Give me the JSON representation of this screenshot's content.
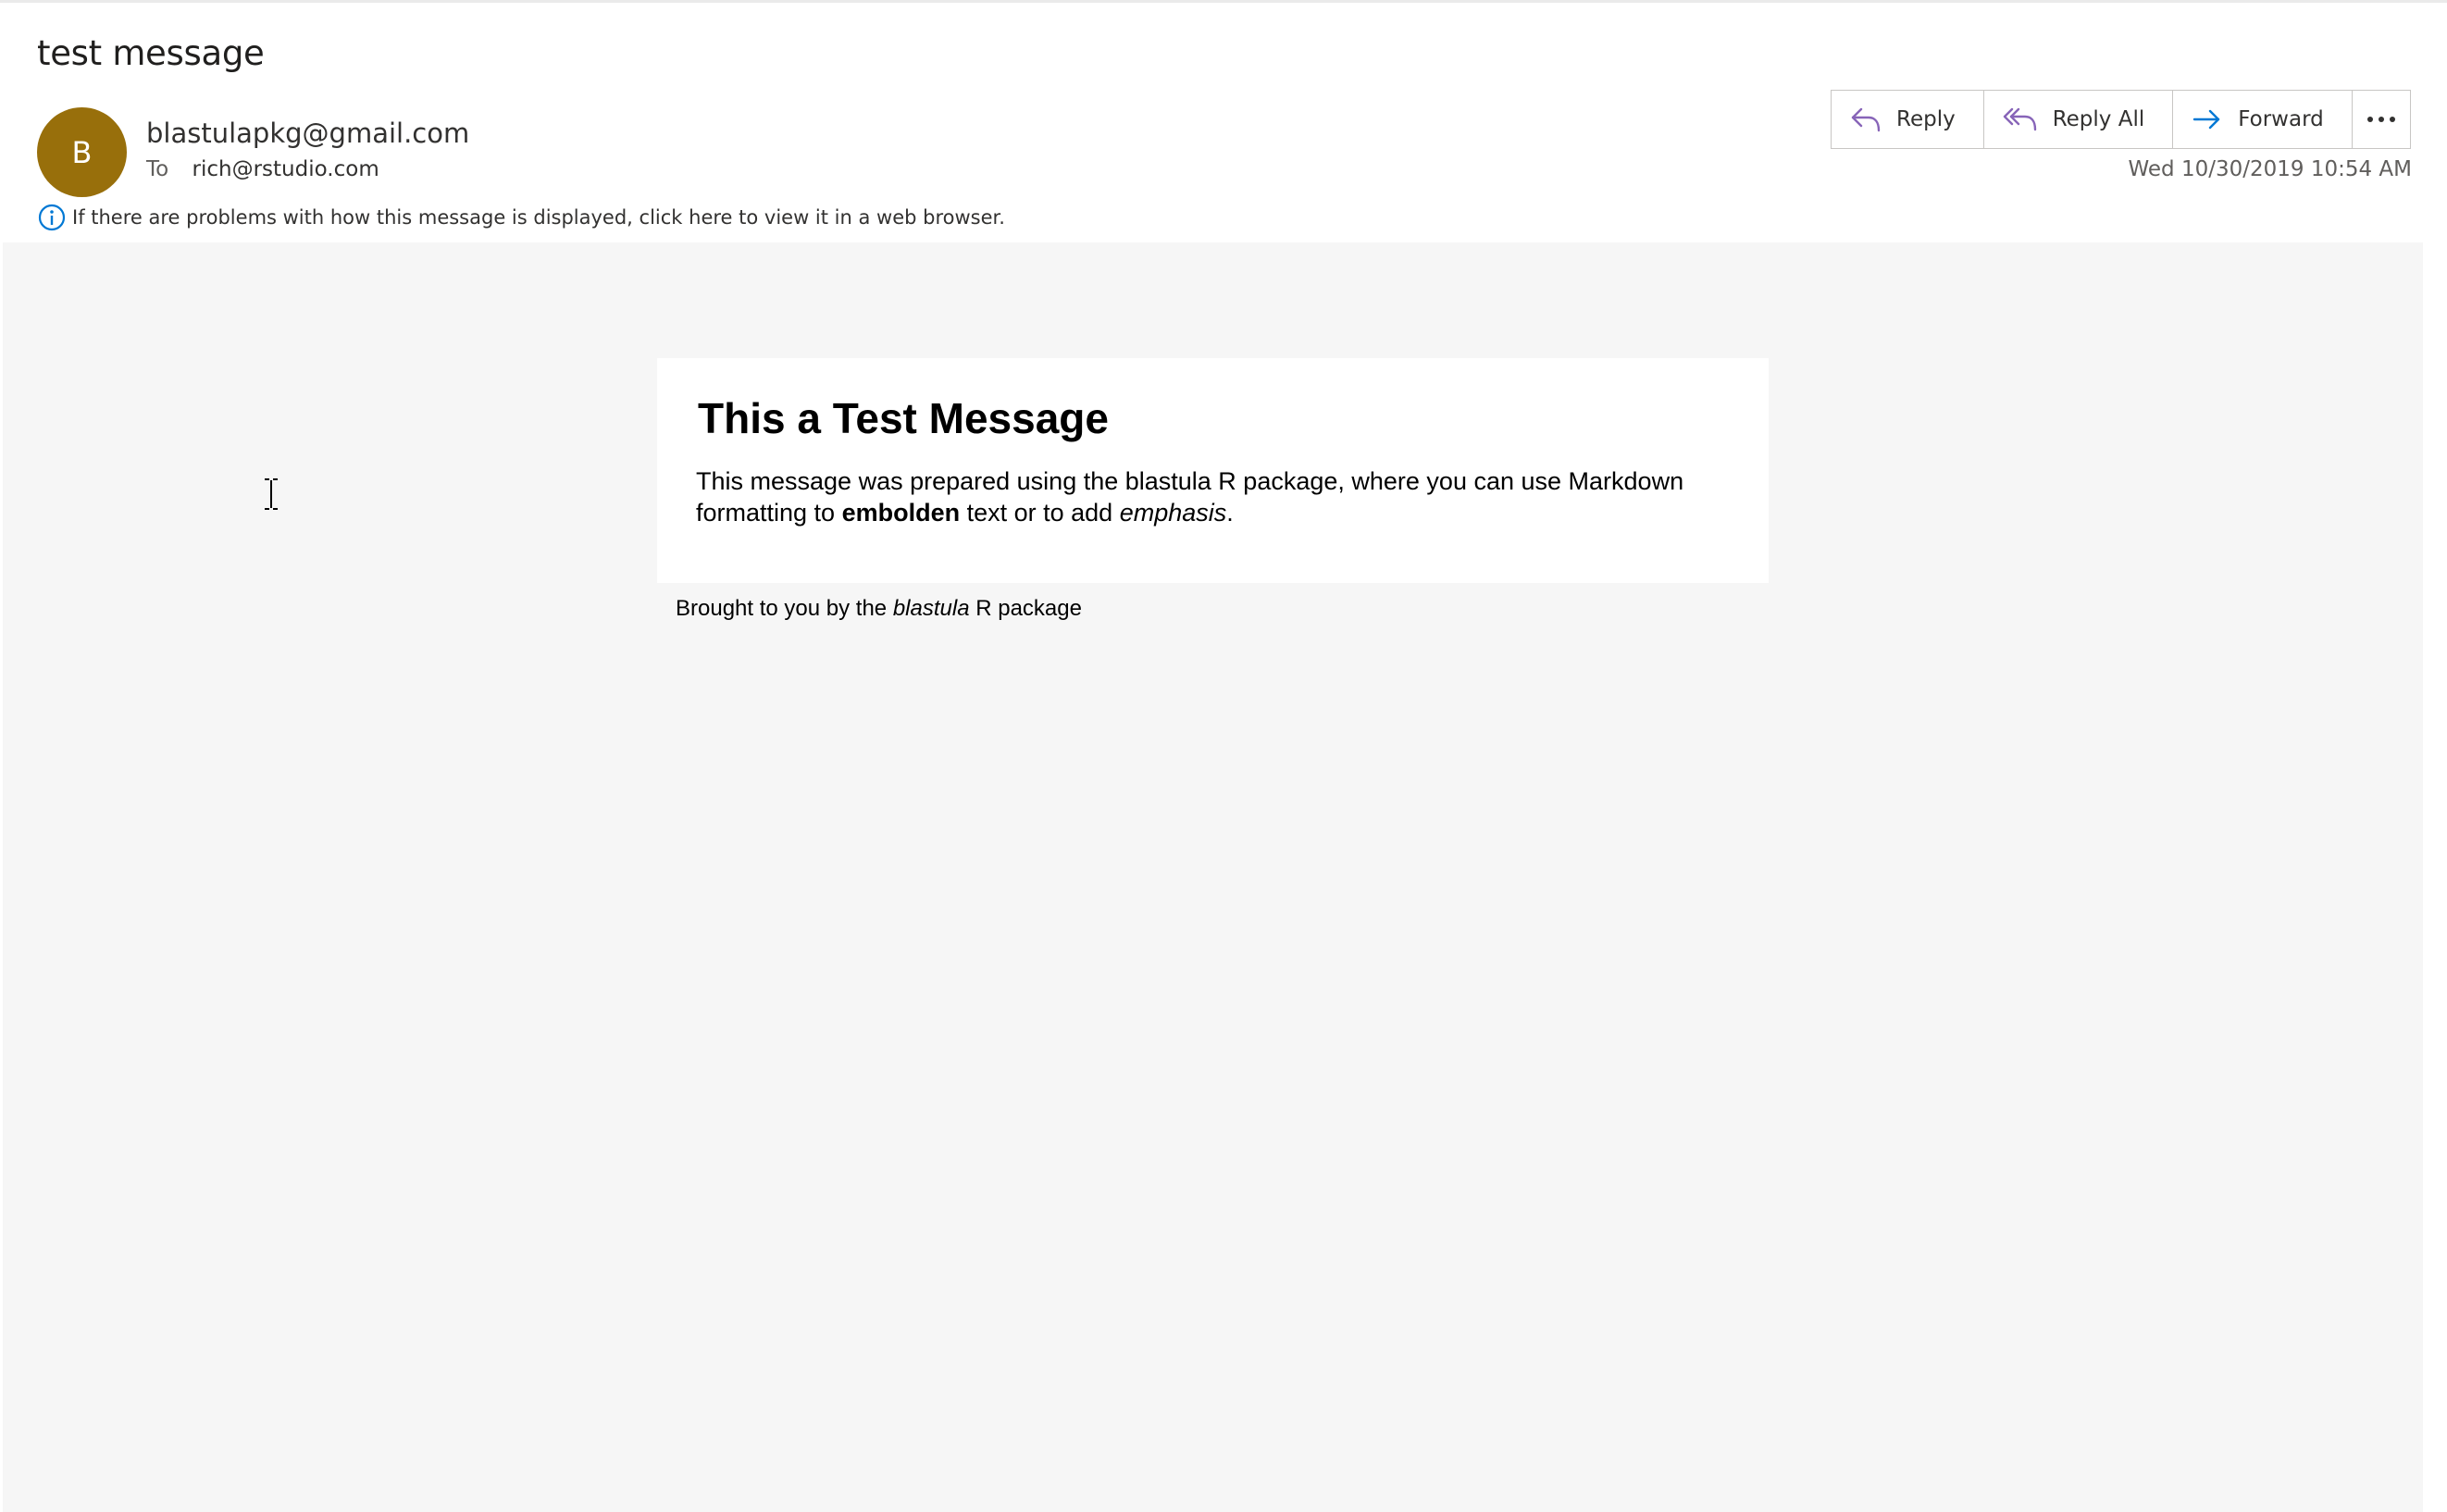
{
  "message": {
    "subject": "test message",
    "sender_initial": "B",
    "sender_email": "blastulapkg@gmail.com",
    "to_label": "To",
    "to_address": "rich@rstudio.com",
    "timestamp": "Wed 10/30/2019 10:54 AM",
    "info_notice": "If there are problems with how this message is displayed, click here to view it in a web browser."
  },
  "actions": {
    "reply": "Reply",
    "reply_all": "Reply All",
    "forward": "Forward",
    "more_label": "···"
  },
  "email_body": {
    "heading": "This a Test Message",
    "para_part1": "This message was prepared using the blastula R package, where you can use Markdown formatting to ",
    "para_bold": "embolden",
    "para_part2": " text or to add ",
    "para_italic": "emphasis",
    "para_part3": ".",
    "footer_part1": "Brought to you by the ",
    "footer_italic": "blastula",
    "footer_part2": " R package"
  },
  "colors": {
    "avatar_bg": "#986f0b",
    "action_icon_purple": "#8764b8",
    "action_icon_blue": "#0078d4",
    "info_icon": "#0078d4",
    "body_bg": "#f6f6f6"
  },
  "icons": {
    "reply": "reply-arrow-icon",
    "reply_all": "reply-all-arrow-icon",
    "forward": "forward-arrow-icon",
    "more": "ellipsis-icon",
    "info": "info-circle-icon",
    "cursor": "text-cursor-icon"
  }
}
